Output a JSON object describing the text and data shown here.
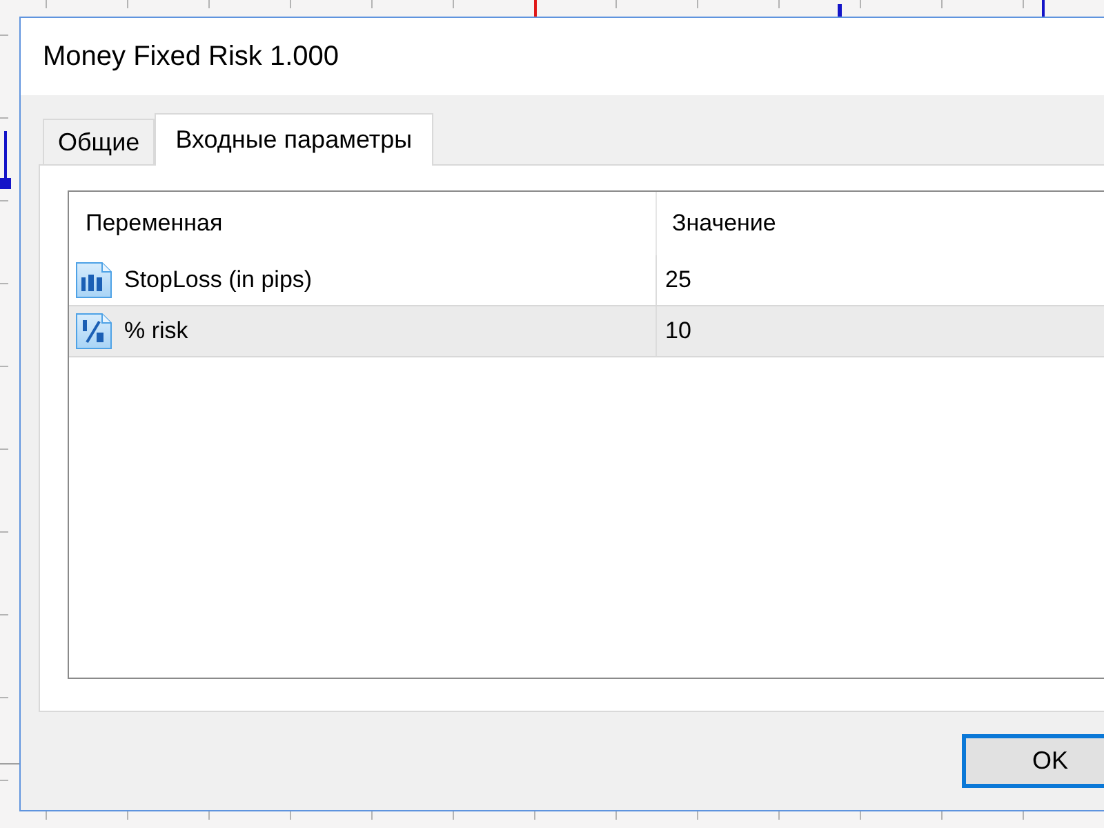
{
  "window": {
    "title": "Money Fixed Risk 1.000"
  },
  "tabs": [
    {
      "label": "Общие",
      "selected": false
    },
    {
      "label": "Входные параметры",
      "selected": true
    }
  ],
  "table": {
    "columns": [
      "Переменная",
      "Значение"
    ],
    "rows": [
      {
        "kind": "integer",
        "name": "StopLoss (in pips)",
        "value": "25",
        "selected": false
      },
      {
        "kind": "fraction",
        "name": "% risk",
        "value": "10",
        "selected": true
      }
    ]
  },
  "buttons": [
    {
      "label": "OK",
      "default": true
    }
  ]
}
